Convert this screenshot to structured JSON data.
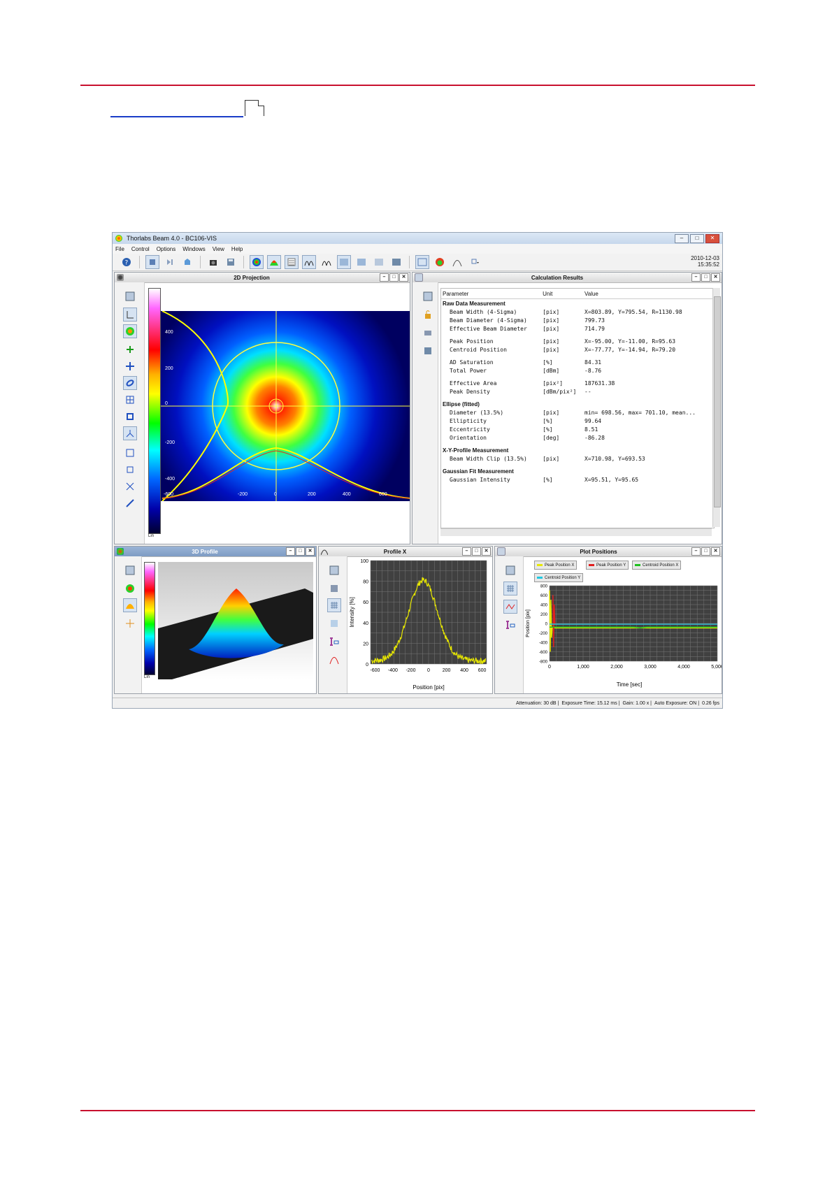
{
  "app": {
    "title": "Thorlabs Beam 4.0 - BC106-VIS",
    "menu": [
      "File",
      "Control",
      "Options",
      "Windows",
      "View",
      "Help"
    ],
    "date": "2010-12-03",
    "time": "15:35:52"
  },
  "panels": {
    "projection_2d": {
      "title": "2D Projection",
      "scale_label": "Lin"
    },
    "calc_results": {
      "title": "Calculation Results"
    },
    "profile_3d": {
      "title": "3D Profile",
      "scale_label": "Lin"
    },
    "profile_x": {
      "title": "Profile X"
    },
    "plot_positions": {
      "title": "Plot Positions"
    }
  },
  "calc_table": {
    "headers": [
      "Parameter",
      "Unit",
      "Value"
    ],
    "rows": [
      {
        "type": "section",
        "param": "Raw Data Measurement",
        "unit": "",
        "value": ""
      },
      {
        "type": "item",
        "param": "Beam Width (4-Sigma)",
        "unit": "[pix]",
        "value": "X=803.89, Y=795.54, R=1130.98"
      },
      {
        "type": "item",
        "param": "Beam Diameter (4-Sigma)",
        "unit": "[pix]",
        "value": "799.73"
      },
      {
        "type": "item",
        "param": "Effective Beam Diameter",
        "unit": "[pix]",
        "value": "714.79"
      },
      {
        "type": "gap"
      },
      {
        "type": "item",
        "param": "Peak Position",
        "unit": "[pix]",
        "value": "X=-95.00, Y=-11.00, R=95.63"
      },
      {
        "type": "item",
        "param": "Centroid Position",
        "unit": "[pix]",
        "value": "X=-77.77, Y=-14.94, R=79.20"
      },
      {
        "type": "gap"
      },
      {
        "type": "item",
        "param": "AD Saturation",
        "unit": "[%]",
        "value": "84.31"
      },
      {
        "type": "item",
        "param": "Total Power",
        "unit": "[dBm]",
        "value": "-8.76"
      },
      {
        "type": "gap"
      },
      {
        "type": "item",
        "param": "Effective Area",
        "unit": "[pix²]",
        "value": "187631.38"
      },
      {
        "type": "item",
        "param": "Peak Density",
        "unit": "[dBm/pix²]",
        "value": "--"
      },
      {
        "type": "gap"
      },
      {
        "type": "section",
        "param": "Ellipse (fitted)",
        "unit": "",
        "value": ""
      },
      {
        "type": "item",
        "param": "Diameter (13.5%)",
        "unit": "[pix]",
        "value": "min= 698.56, max= 701.10, mean..."
      },
      {
        "type": "item",
        "param": "Ellipticity",
        "unit": "[%]",
        "value": "99.64"
      },
      {
        "type": "item",
        "param": "Eccentricity",
        "unit": "[%]",
        "value": "8.51"
      },
      {
        "type": "item",
        "param": "Orientation",
        "unit": "[deg]",
        "value": "-86.28"
      },
      {
        "type": "gap"
      },
      {
        "type": "section",
        "param": "X-Y-Profile Measurement",
        "unit": "",
        "value": ""
      },
      {
        "type": "item",
        "param": "Beam Width Clip (13.5%)",
        "unit": "[pix]",
        "value": "X=710.98, Y=693.53"
      },
      {
        "type": "gap"
      },
      {
        "type": "section",
        "param": "Gaussian Fit Measurement",
        "unit": "",
        "value": ""
      },
      {
        "type": "item",
        "param": "Gaussian Intensity",
        "unit": "[%]",
        "value": "X=95.51, Y=95.65"
      }
    ]
  },
  "projection_axes": {
    "x_ticks": [
      "-600",
      "-200",
      "0",
      "200",
      "400",
      "600"
    ],
    "y_ticks": [
      "400",
      "200",
      "0",
      "-200",
      "-400"
    ]
  },
  "profile_x_chart": {
    "type": "line",
    "title": "",
    "xlabel": "Position [pix]",
    "ylabel": "Intensity [%]",
    "xlim": [
      -650,
      650
    ],
    "ylim": [
      0,
      100
    ],
    "x_ticks": [
      "-600",
      "-400",
      "-200",
      "0",
      "200",
      "400",
      "600"
    ],
    "y_ticks": [
      "100",
      "80",
      "60",
      "40",
      "20",
      "0"
    ],
    "series_color": "#e8e800"
  },
  "plot_positions_chart": {
    "type": "line",
    "xlabel": "Time [sec]",
    "ylabel": "Position [pix]",
    "xlim": [
      0,
      5000
    ],
    "ylim": [
      -800,
      800
    ],
    "x_ticks": [
      "0",
      "1,000",
      "2,000",
      "3,000",
      "4,000",
      "5,000"
    ],
    "y_ticks": [
      "800",
      "600",
      "400",
      "200",
      "0",
      "-200",
      "-400",
      "-600",
      "-800"
    ],
    "legend": [
      "Peak Position X",
      "Peak Position Y",
      "Centroid Position X",
      "Centroid Position Y"
    ],
    "legend_colors": [
      "#e8e800",
      "#e02020",
      "#20c020",
      "#20c8e0"
    ]
  },
  "status": {
    "attenuation": "Attenuation: 30 dB |",
    "exposure": "Exposure Time: 15.12 ms |",
    "gain": "Gain: 1.00 x |",
    "auto_exposure": "Auto Exposure: ON |",
    "fps": "0.26 fps"
  }
}
